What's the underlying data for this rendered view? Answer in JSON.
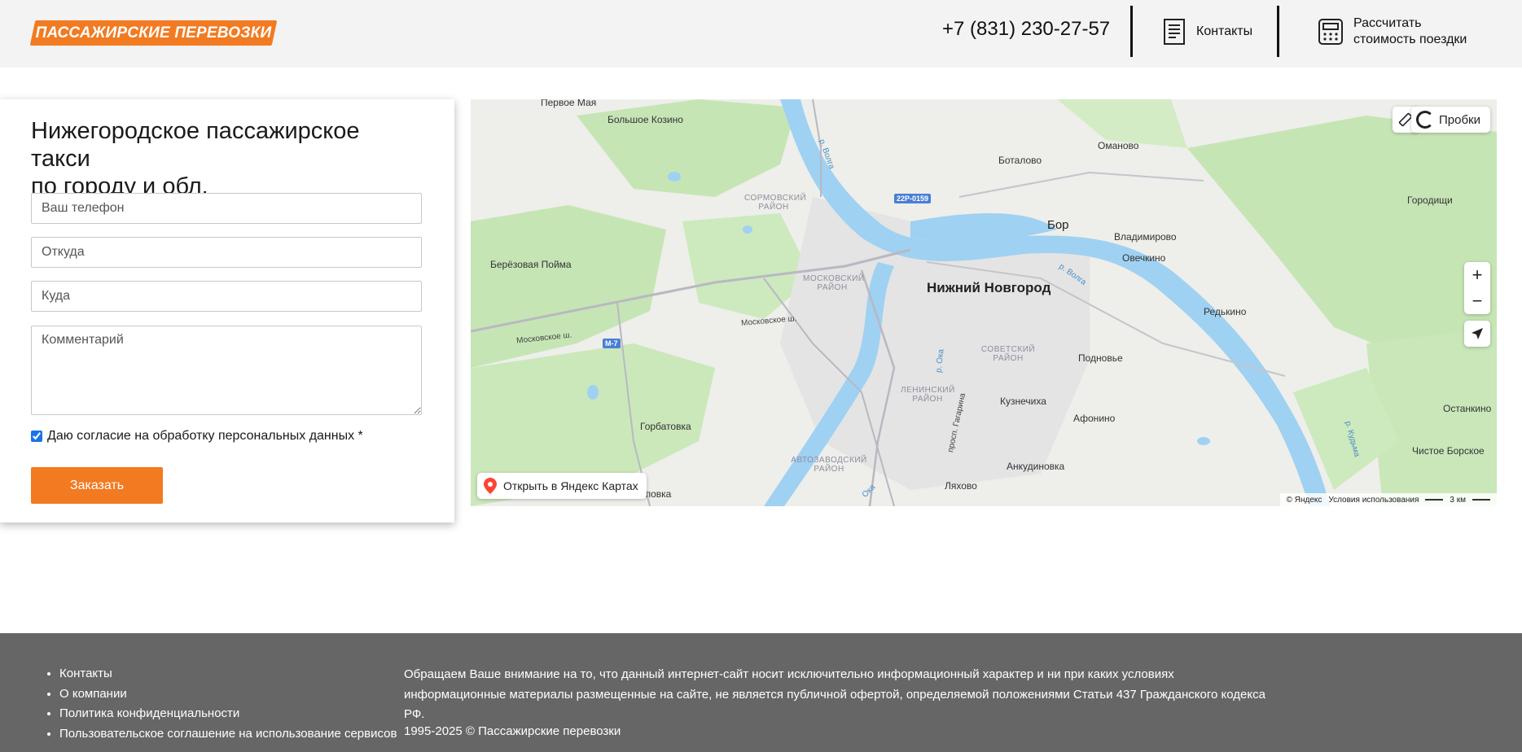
{
  "header": {
    "logo_text": "ПАССАЖИРСКИЕ ПЕРЕВОЗКИ",
    "phone": "+7 (831) 230-27-57",
    "contacts_label": "Контакты",
    "calc_label_line1": "Рассчитать",
    "calc_label_line2": "стоимость поездки"
  },
  "form": {
    "title_line1": "Нижегородское пассажирское такси",
    "title_line2": "по городу и обл.",
    "phone_placeholder": "Ваш телефон",
    "from_placeholder": "Откуда",
    "to_placeholder": "Куда",
    "comment_placeholder": "Комментарий",
    "consent_label": "Даю согласие на обработку персональных данных",
    "consent_required_mark": "*",
    "consent_checked": true,
    "submit_label": "Заказать"
  },
  "map": {
    "traffic_label": "Пробки",
    "open_label": "Открыть в Яндекс Картах",
    "attribution": "© Яндекс",
    "terms": "Условия использования",
    "scale": "3 км",
    "labels": {
      "city": "Нижний Новгород",
      "bor": "Бор",
      "pervoe_maya": "Первое Мая",
      "bolshoe_kozino": "Большое Козино",
      "omanovo": "Оманово",
      "botalovo": "Боталово",
      "gorodishchi": "Городищи",
      "vladimirovo": "Владимирово",
      "ovechkino": "Овечкино",
      "berezovaya_poyma": "Берёзовая Пойма",
      "redkino": "Редькино",
      "podnovye": "Подновье",
      "kuznechikha": "Кузнечиха",
      "afonino": "Афонино",
      "ostankino": "Останкино",
      "chistoe_borskoe": "Чистое Борское",
      "gorbatovka": "Горбатовка",
      "ankudinovka": "Анкудиновка",
      "lyakhovo": "Ляхово",
      "lipovka": "Липовка",
      "sormovsky": "СОРМОВСКИЙ РАЙОН",
      "moskovsky": "МОСКОВСКИЙ РАЙОН",
      "sovetsky": "СОВЕТСКИЙ РАЙОН",
      "leninsky": "ЛЕНИНСКИЙ РАЙОН",
      "avtozavodsky": "АВТОЗАВОДСКИЙ РАЙОН",
      "moskovskoe_sh_1": "Московское ш.",
      "moskovskoe_sh_2": "Московское ш.",
      "pr_gagarina": "просп. Гагарина",
      "volga_1": "р. Волга",
      "volga_2": "р. Волга",
      "oka_1": "р. Ока",
      "oka_2": "Ока",
      "kudma": "р. Кудьма",
      "shield_m7": "М-7",
      "shield_22r": "22Р-0159"
    }
  },
  "footer": {
    "links": [
      "Контакты",
      "О компании",
      "Политика конфиденциальности",
      "Пользовательское соглашение на использование сервисов"
    ],
    "disclaimer": "Обращаем Ваше внимание на то, что данный интернет-сайт носит исключительно информационный характер и ни при каких условиях информационные материалы размещенные на сайте, не является публичной офертой, определяемой положениями Статьи 437 Гражданского кодекса РФ.",
    "copyright": "1995-2025 © Пассажирские перевозки"
  },
  "colors": {
    "accent": "#f27a21",
    "header_bg": "#f3f3f3",
    "footer_bg": "#666666",
    "water": "#9fd1f2",
    "forest": "#c6e5b5"
  }
}
